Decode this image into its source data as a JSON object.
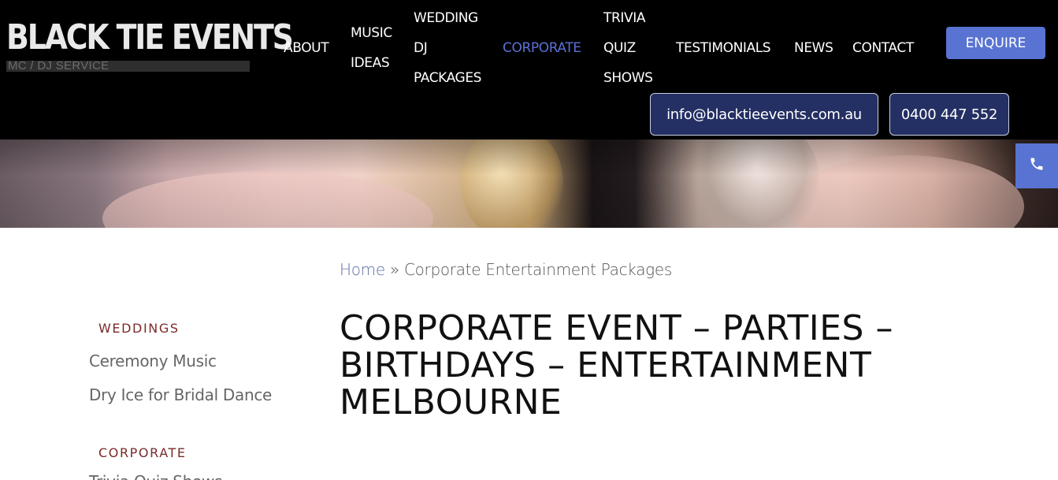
{
  "logo": {
    "title": "BLACK TIE EVENTS",
    "subtitle": "MC / DJ SERVICE"
  },
  "nav": {
    "about": "ABOUT",
    "music_ideas": [
      "MUSIC",
      "IDEAS"
    ],
    "wedding": [
      "WEDDING",
      "DJ",
      "PACKAGES"
    ],
    "corporate": "CORPORATE",
    "trivia": [
      "TRIVIA",
      "QUIZ",
      "SHOWS"
    ],
    "testimonials": "TESTIMONIALS",
    "news": "NEWS",
    "contact": "CONTACT",
    "active": "CORPORATE",
    "active_color": "#5b71d6"
  },
  "enquire_label": "ENQUIRE",
  "contact": {
    "email": "info@blacktieevents.com.au",
    "phone": "0400 447 552"
  },
  "breadcrumb": {
    "home": "Home",
    "separator": "»",
    "current": "Corporate Entertainment Packages"
  },
  "page_title": "CORPORATE EVENT – PARTIES – BIRTHDAYS – ENTERTAINMENT MELBOURNE",
  "sidebar": {
    "weddings_heading": "WEDDINGS",
    "weddings_items": [
      "Ceremony Music",
      "Dry Ice for Bridal Dance"
    ],
    "corporate_heading": "CORPORATE",
    "corporate_items": [
      "Trivia Quiz Shows"
    ]
  },
  "colors": {
    "accent": "#5873d2",
    "pill_bg": "#242f63",
    "sidebar_heading": "#7a2a2a",
    "link": "#5e6fa8"
  },
  "icons": {
    "phone_tab": "phone-icon"
  }
}
